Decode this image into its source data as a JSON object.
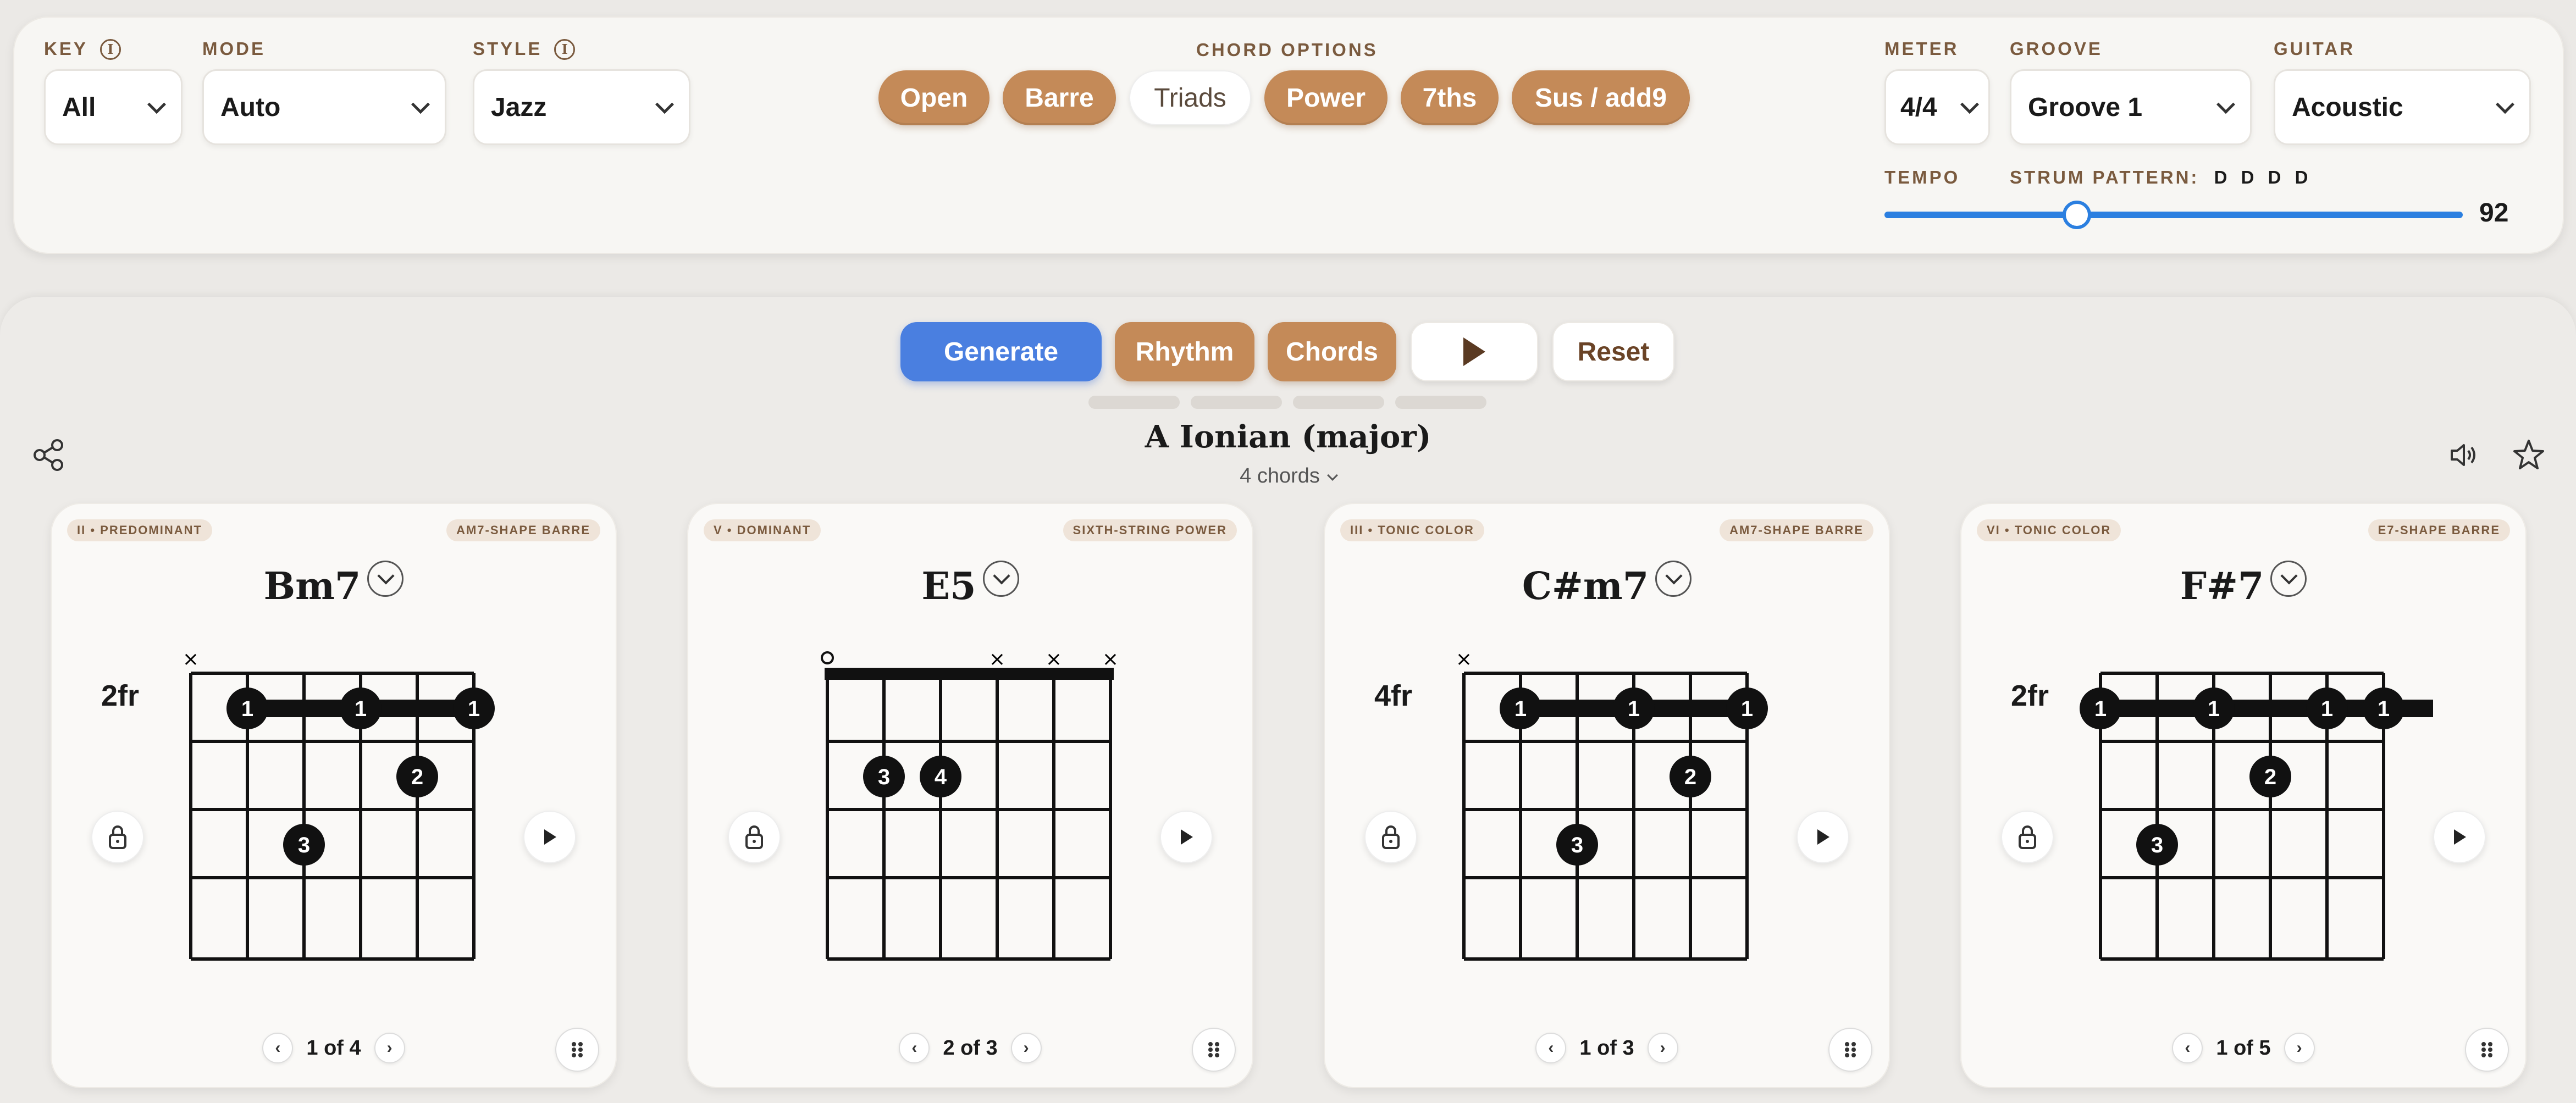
{
  "controls": {
    "key": {
      "label": "KEY",
      "value": "All"
    },
    "mode": {
      "label": "MODE",
      "value": "Auto"
    },
    "style": {
      "label": "STYLE",
      "value": "Jazz"
    },
    "chord_options": {
      "label": "CHORD OPTIONS",
      "items": [
        {
          "label": "Open",
          "active": true
        },
        {
          "label": "Barre",
          "active": true
        },
        {
          "label": "Triads",
          "active": false
        },
        {
          "label": "Power",
          "active": true
        },
        {
          "label": "7ths",
          "active": true
        },
        {
          "label": "Sus / add9",
          "active": true
        }
      ]
    },
    "meter": {
      "label": "METER",
      "value": "4/4"
    },
    "groove": {
      "label": "GROOVE",
      "value": "Groove 1"
    },
    "guitar": {
      "label": "GUITAR",
      "value": "Acoustic"
    },
    "tempo": {
      "label": "TEMPO",
      "value": "92",
      "fraction": 0.23
    },
    "strum": {
      "label": "STRUM PATTERN:",
      "value": "D D D D"
    },
    "info_glyph": "i"
  },
  "actions": {
    "generate": "Generate",
    "rhythm": "Rhythm",
    "chords": "Chords",
    "reset": "Reset"
  },
  "progression": {
    "title": "A Ionian (major)",
    "count_label": "4 chords"
  },
  "cards": [
    {
      "function": "II • PREDOMINANT",
      "shape": "AM7-SHAPE BARRE",
      "name": "Bm7",
      "fret_label": "2fr",
      "pager": "1 of 4"
    },
    {
      "function": "V • DOMINANT",
      "shape": "SIXTH-STRING POWER",
      "name": "E5",
      "fret_label": "",
      "pager": "2 of 3"
    },
    {
      "function": "III • TONIC COLOR",
      "shape": "AM7-SHAPE BARRE",
      "name": "C#m7",
      "fret_label": "4fr",
      "pager": "1 of 3"
    },
    {
      "function": "VI • TONIC COLOR",
      "shape": "E7-SHAPE BARRE",
      "name": "F#7",
      "fret_label": "2fr",
      "pager": "1 of 5"
    }
  ],
  "colors": {
    "accent_brown": "#c48a58",
    "accent_blue": "#4a7fe0",
    "label_brown": "#7a5a3e",
    "background": "#ebe9e6"
  }
}
